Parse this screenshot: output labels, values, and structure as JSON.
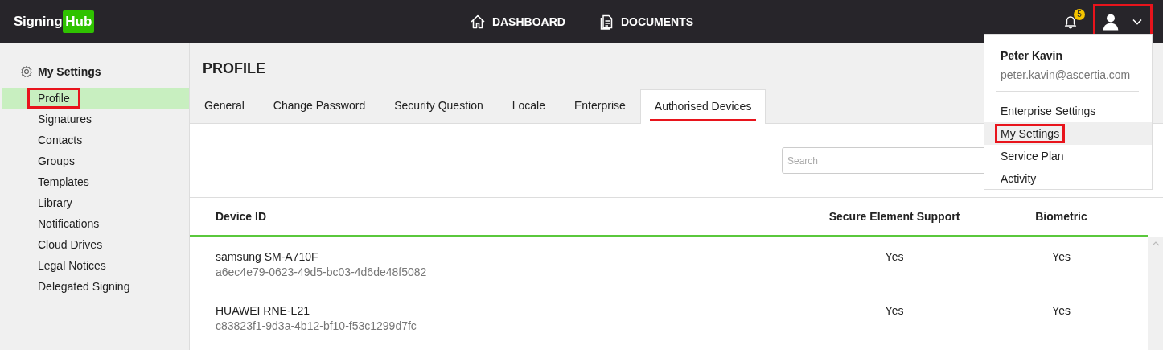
{
  "header": {
    "logo": {
      "text": "Signing",
      "badge": "Hub"
    },
    "nav": [
      {
        "label": "DASHBOARD"
      },
      {
        "label": "DOCUMENTS"
      }
    ],
    "notifications": {
      "count": "5"
    },
    "user_button": {
      "highlighted": true
    }
  },
  "user_dropdown": {
    "name": "Peter Kavin",
    "email": "peter.kavin@ascertia.com",
    "items": [
      {
        "label": "Enterprise Settings",
        "selected": false,
        "highlighted": false
      },
      {
        "label": "My Settings",
        "selected": true,
        "highlighted": true
      },
      {
        "label": "Service Plan",
        "selected": false,
        "highlighted": false
      },
      {
        "label": "Activity",
        "selected": false,
        "highlighted": false
      }
    ]
  },
  "sidebar": {
    "title": "My Settings",
    "items": [
      {
        "label": "Profile",
        "selected": true,
        "highlighted": true
      },
      {
        "label": "Signatures",
        "selected": false,
        "highlighted": false
      },
      {
        "label": "Contacts",
        "selected": false,
        "highlighted": false
      },
      {
        "label": "Groups",
        "selected": false,
        "highlighted": false
      },
      {
        "label": "Templates",
        "selected": false,
        "highlighted": false
      },
      {
        "label": "Library",
        "selected": false,
        "highlighted": false
      },
      {
        "label": "Notifications",
        "selected": false,
        "highlighted": false
      },
      {
        "label": "Cloud Drives",
        "selected": false,
        "highlighted": false
      },
      {
        "label": "Legal Notices",
        "selected": false,
        "highlighted": false
      },
      {
        "label": "Delegated Signing",
        "selected": false,
        "highlighted": false
      }
    ]
  },
  "page": {
    "title": "PROFILE",
    "tabs": [
      {
        "label": "General",
        "selected": false,
        "highlighted": false
      },
      {
        "label": "Change Password",
        "selected": false,
        "highlighted": false
      },
      {
        "label": "Security Question",
        "selected": false,
        "highlighted": false
      },
      {
        "label": "Locale",
        "selected": false,
        "highlighted": false
      },
      {
        "label": "Enterprise",
        "selected": false,
        "highlighted": false
      },
      {
        "label": "Authorised Devices",
        "selected": true,
        "highlighted": true
      }
    ],
    "search": {
      "placeholder": "Search"
    },
    "table": {
      "columns": [
        "Device ID",
        "Secure Element Support",
        "Biometric"
      ],
      "rows": [
        {
          "device": "samsung SM-A710F",
          "device_id": "a6ec4e79-0623-49d5-bc03-4d6de48f5082",
          "secure_element": "Yes",
          "biometric": "Yes"
        },
        {
          "device": "HUAWEI RNE-L21",
          "device_id": "c83823f1-9d3a-4b12-bf10-f53c1299d7fc",
          "secure_element": "Yes",
          "biometric": "Yes"
        }
      ]
    }
  }
}
